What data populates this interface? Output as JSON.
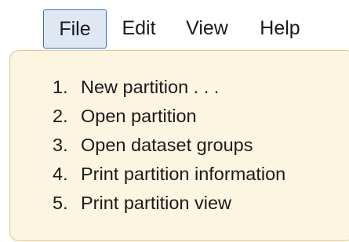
{
  "menubar": {
    "items": [
      {
        "label": "File",
        "active": true
      },
      {
        "label": "Edit",
        "active": false
      },
      {
        "label": "View",
        "active": false
      },
      {
        "label": "Help",
        "active": false
      }
    ]
  },
  "dropdown": {
    "items": [
      {
        "number": "1.",
        "label": "New partition . . ."
      },
      {
        "number": "2.",
        "label": "Open partition"
      },
      {
        "number": "3.",
        "label": "Open dataset groups"
      },
      {
        "number": "4.",
        "label": "Print partition information"
      },
      {
        "number": "5.",
        "label": "Print partition view"
      }
    ]
  },
  "colors": {
    "active_menu_border": "#3a72c4",
    "active_menu_bg": "#dfe7f2",
    "dropdown_bg": "#fcf5e2",
    "dropdown_border": "#e2c78f"
  }
}
